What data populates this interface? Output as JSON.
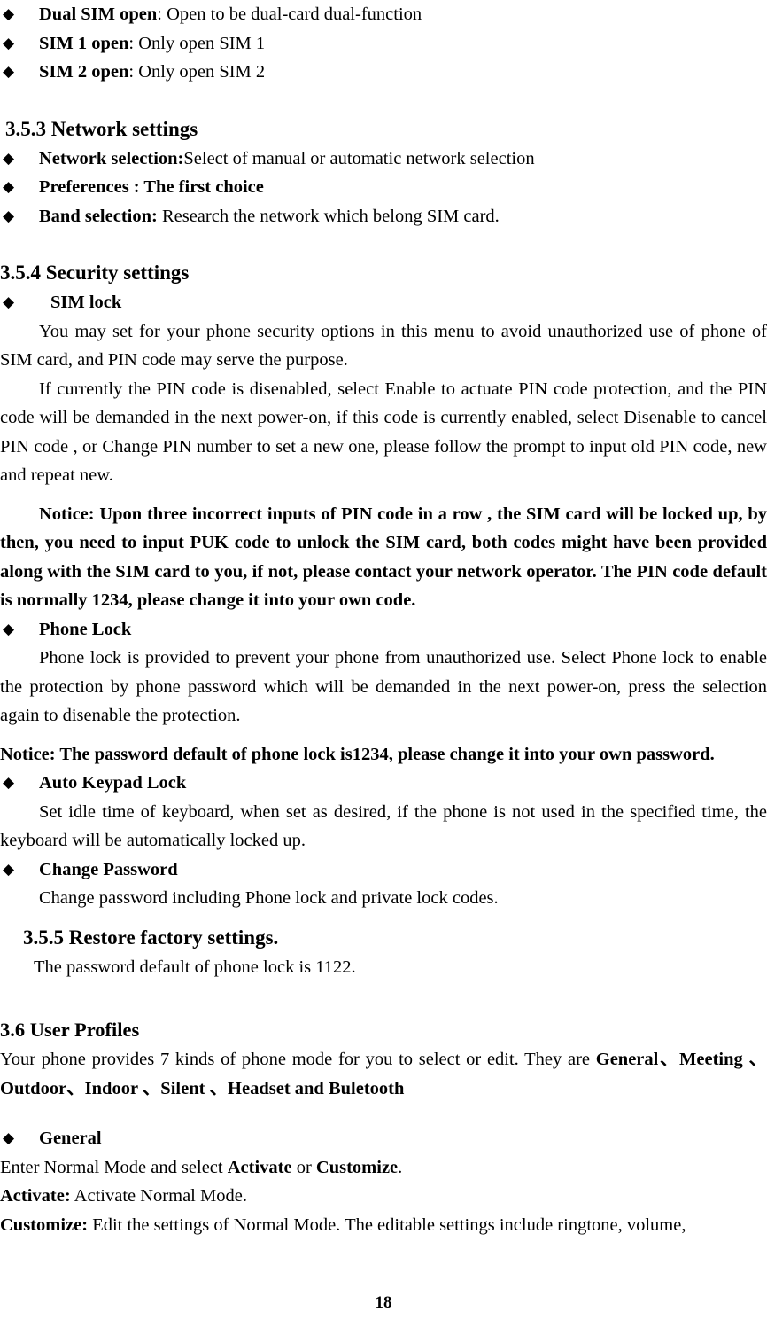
{
  "document": {
    "page_number": "18",
    "bullet_glyph": "◆"
  },
  "sim_mode_bullets": [
    {
      "label": "Dual SIM open",
      "sep": ": ",
      "text": "Open to be dual-card dual-function"
    },
    {
      "label": "SIM 1 open",
      "sep": ": ",
      "text": "Only open SIM 1"
    },
    {
      "label": "SIM 2 open",
      "sep": ": ",
      "text": "Only open SIM 2"
    }
  ],
  "network_settings": {
    "heading": "3.5.3 Network settings",
    "bullets": [
      {
        "label": "Network selection:",
        "text": "Select of manual or automatic network selection"
      },
      {
        "label": "Preferences : The first choice",
        "text": ""
      },
      {
        "label": "Band selection:",
        "text": " Research the network which belong SIM card."
      }
    ]
  },
  "security_settings": {
    "heading": "3.5.4 Security settings",
    "sim_lock": {
      "label": "SIM lock",
      "para1": "You may set for your phone security options in this menu to avoid unauthorized use of phone of SIM card, and PIN code may serve the purpose.",
      "para2": "If currently the PIN code is disenabled, select Enable to actuate PIN code protection, and the PIN code will be demanded in the next power-on, if this code is currently enabled, select Disenable to cancel PIN code , or Change PIN number to set a new one, please follow the prompt to input old PIN code, new and repeat new.",
      "notice": "Notice: Upon three incorrect inputs of PIN code in a row , the SIM card will be locked up, by then, you need to input PUK code to unlock the SIM card, both codes might have been provided along with the SIM card to you, if not, please contact your network operator. The PIN code default is normally 1234, please change it into your own code."
    },
    "phone_lock": {
      "label": "Phone Lock",
      "para": "Phone lock is provided to prevent your phone from unauthorized use. Select Phone lock to enable the protection by phone password which will be demanded in the next power-on, press the selection again to disenable the protection.",
      "notice": "Notice: The password default of phone lock is1234, please change it into your own password."
    },
    "auto_keypad_lock": {
      "label": "Auto Keypad Lock",
      "para": "Set idle time of keyboard, when set as desired, if the phone is not used in the specified time, the keyboard will be automatically locked up."
    },
    "change_password": {
      "label": "Change Password",
      "para": "Change password including Phone lock and private lock codes."
    }
  },
  "restore_factory": {
    "heading": "3.5.5 Restore factory settings.",
    "line": "The password default of phone lock is 1122."
  },
  "user_profiles": {
    "heading": "3.6 User Profiles",
    "intro_plain_1": "Your phone provides 7 kinds of phone mode for you to select or edit. They are ",
    "intro_bold": "General、Meeting 、Outdoor、Indoor 、Silent 、Headset and Buletooth",
    "general": {
      "label": "General",
      "line1_pre": "Enter Normal Mode and select ",
      "line1_bold_a": "Activate",
      "line1_mid": " or ",
      "line1_bold_b": "Customize",
      "line1_post": ".",
      "line2_bold": "Activate:",
      "line2_text": " Activate Normal Mode.",
      "line3_bold": "Customize:",
      "line3_text": " Edit the settings of Normal Mode. The editable settings include ringtone, volume,"
    }
  }
}
